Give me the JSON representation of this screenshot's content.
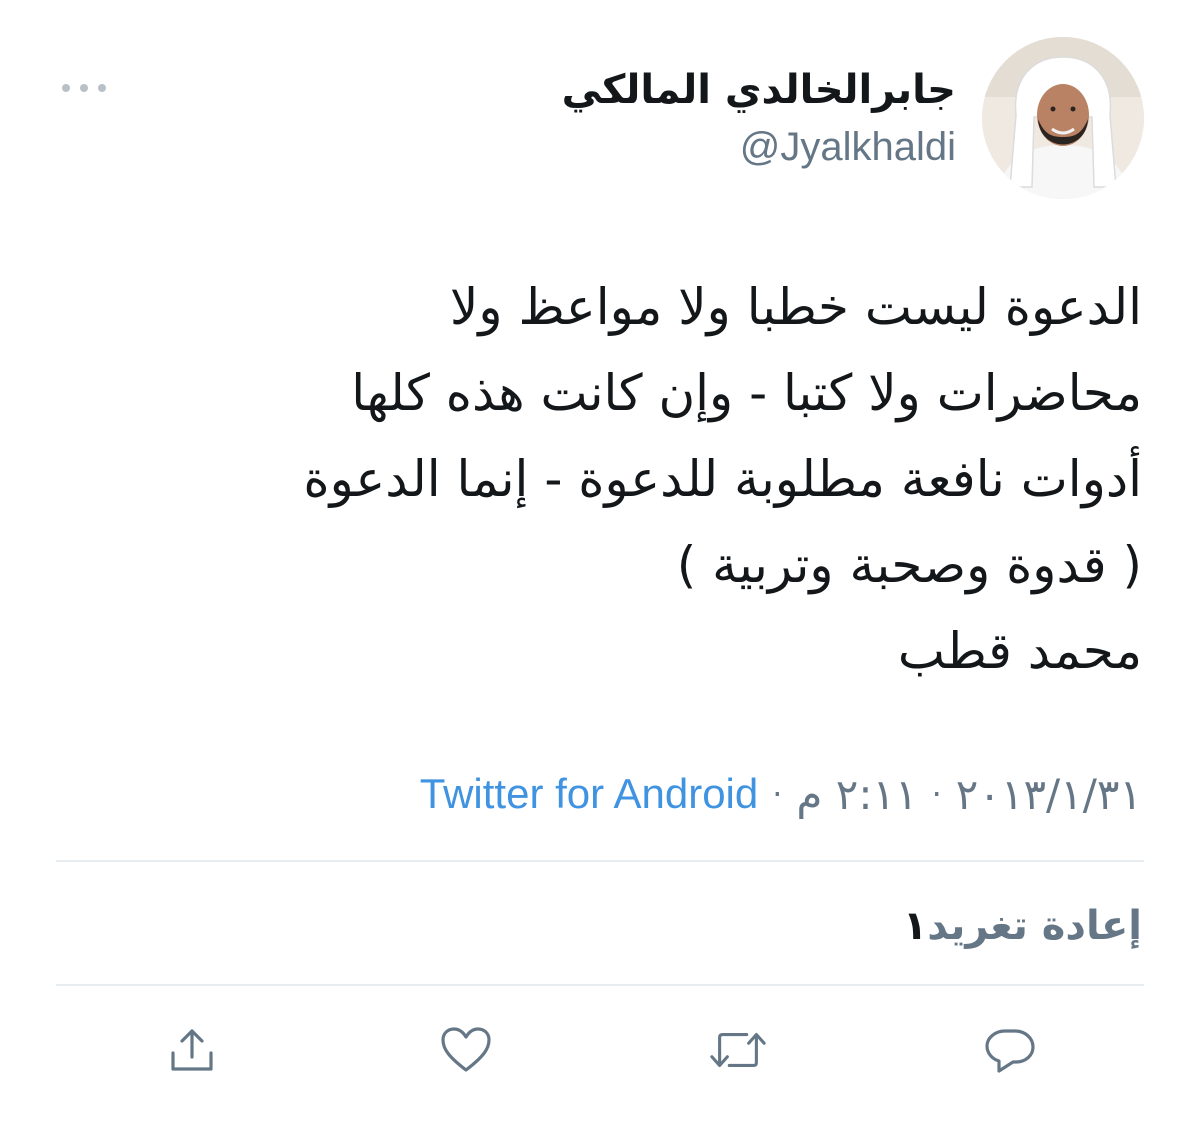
{
  "tweet": {
    "display_name": "جابرالخالدي المالكي",
    "handle": "@Jyalkhaldi",
    "text_lines": [
      "الدعوة ليست خطبا ولا مواعظ ولا",
      "محاضرات ولا كتبا - وإن كانت هذه كلها",
      "أدوات نافعة مطلوبة للدعوة - إنما الدعوة",
      "( قدوة وصحبة وتربية  )",
      "محمد قطب"
    ],
    "date": "٢٠١٣/١/٣١",
    "time": "٢:١١ م",
    "separator": "·",
    "source": "Twitter for Android",
    "retweet_count": "١",
    "retweet_label": "إعادة تغريد"
  },
  "icons": {
    "more": "more-dots-icon",
    "reply": "reply-bubble-icon",
    "retweet": "retweet-arrows-icon",
    "like": "heart-icon",
    "share": "share-upload-icon"
  },
  "colors": {
    "text": "#14171a",
    "secondary": "#657786",
    "link": "#3f93e0",
    "divider": "#e6ecf0",
    "icon": "#657786"
  }
}
